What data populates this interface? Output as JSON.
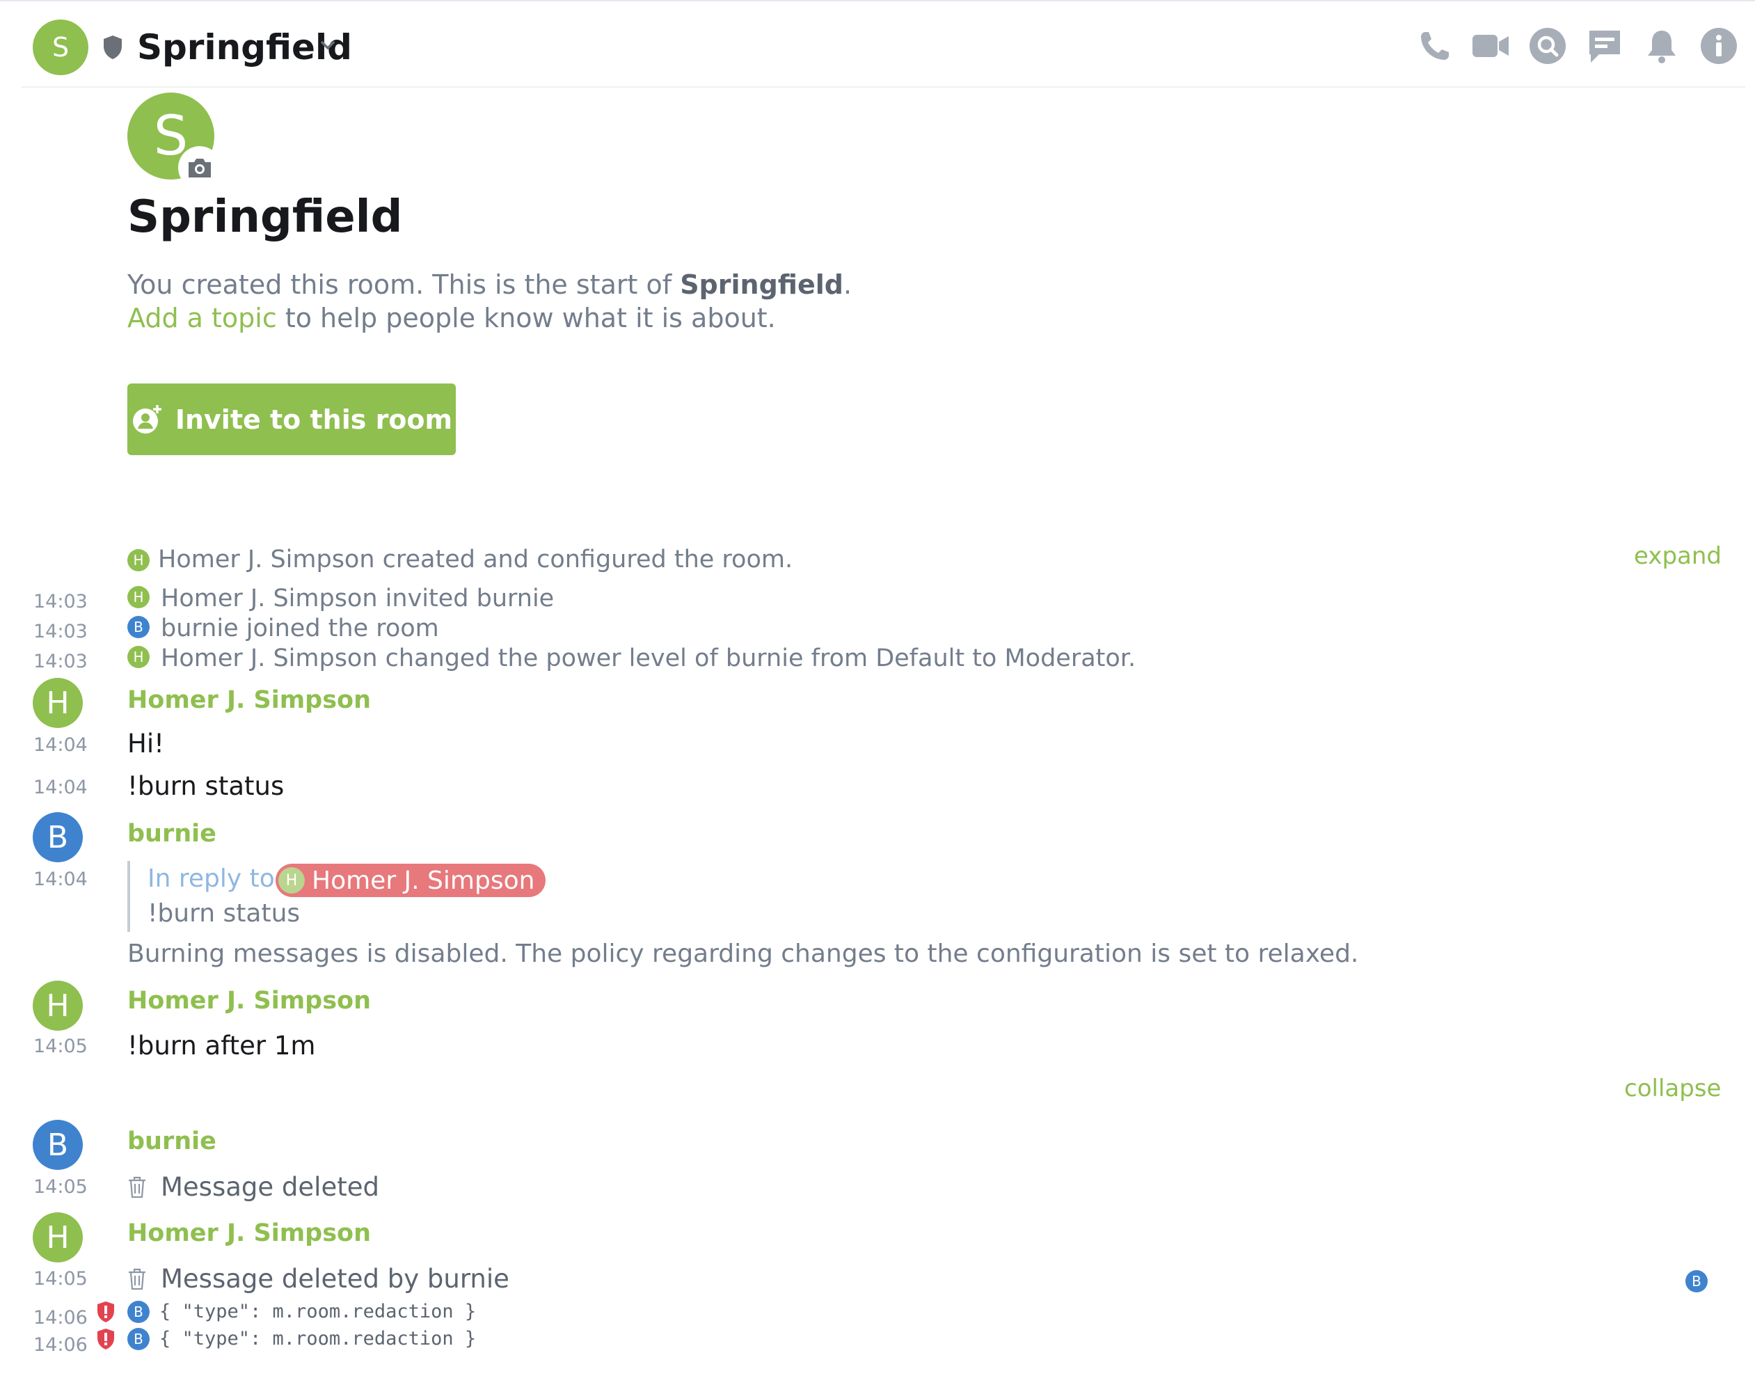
{
  "header": {
    "avatar_letter": "S",
    "room_name": "Springfield",
    "icons": [
      "voice-call-icon",
      "video-call-icon",
      "search-icon",
      "threads-icon",
      "notifications-icon",
      "room-info-icon"
    ]
  },
  "intro": {
    "avatar_letter": "S",
    "title": "Springfield",
    "line1_prefix": "You created this room. This is the start of ",
    "line1_room": "Springfield",
    "line1_suffix": ".",
    "topic_link": "Add a topic",
    "line2_suffix": " to help people know what it is about.",
    "invite_label": "Invite to this room"
  },
  "state_events": {
    "created": {
      "avatar": "H",
      "text": "Homer J. Simpson created and configured the room."
    },
    "expand_label": "expand",
    "items": [
      {
        "time": "14:03",
        "avatar": "H",
        "text": "Homer J. Simpson invited burnie"
      },
      {
        "time": "14:03",
        "avatar": "B",
        "text": "burnie joined the room"
      },
      {
        "time": "14:03",
        "avatar": "H",
        "text": "Homer J. Simpson changed the power level of burnie from Default to Moderator."
      }
    ]
  },
  "timeline": {
    "g1": {
      "avatar": "H",
      "sender": "Homer J. Simpson",
      "messages": [
        {
          "time": "14:04",
          "body": "Hi!"
        },
        {
          "time": "14:04",
          "body": "!burn status"
        }
      ]
    },
    "g2": {
      "avatar": "B",
      "sender": "burnie",
      "time": "14:04",
      "reply_prefix": "In reply to",
      "reply_avatar": "H",
      "reply_user": "Homer J. Simpson",
      "reply_quote": "!burn status",
      "body": "Burning messages is disabled. The policy regarding changes to the configuration is set to relaxed."
    },
    "g3": {
      "avatar": "H",
      "sender": "Homer J. Simpson",
      "time": "14:05",
      "body": "!burn after 1m"
    },
    "collapse_label": "collapse",
    "g4": {
      "avatar": "B",
      "sender": "burnie",
      "time": "14:05",
      "body": "Message deleted"
    },
    "g5": {
      "avatar": "H",
      "sender": "Homer J. Simpson",
      "time": "14:05",
      "body": "Message deleted by burnie",
      "read_receipt": "B"
    },
    "raw": [
      {
        "time": "14:06",
        "avatar": "B",
        "code": "{ \"type\": m.room.redaction }"
      },
      {
        "time": "14:06",
        "avatar": "B",
        "code": "{ \"type\": m.room.redaction }"
      }
    ]
  },
  "colors": {
    "accent": "#8fbf4f",
    "blue_avatar": "#3f83cf",
    "mention_pill": "#e7787b",
    "warning": "#e2434f"
  }
}
